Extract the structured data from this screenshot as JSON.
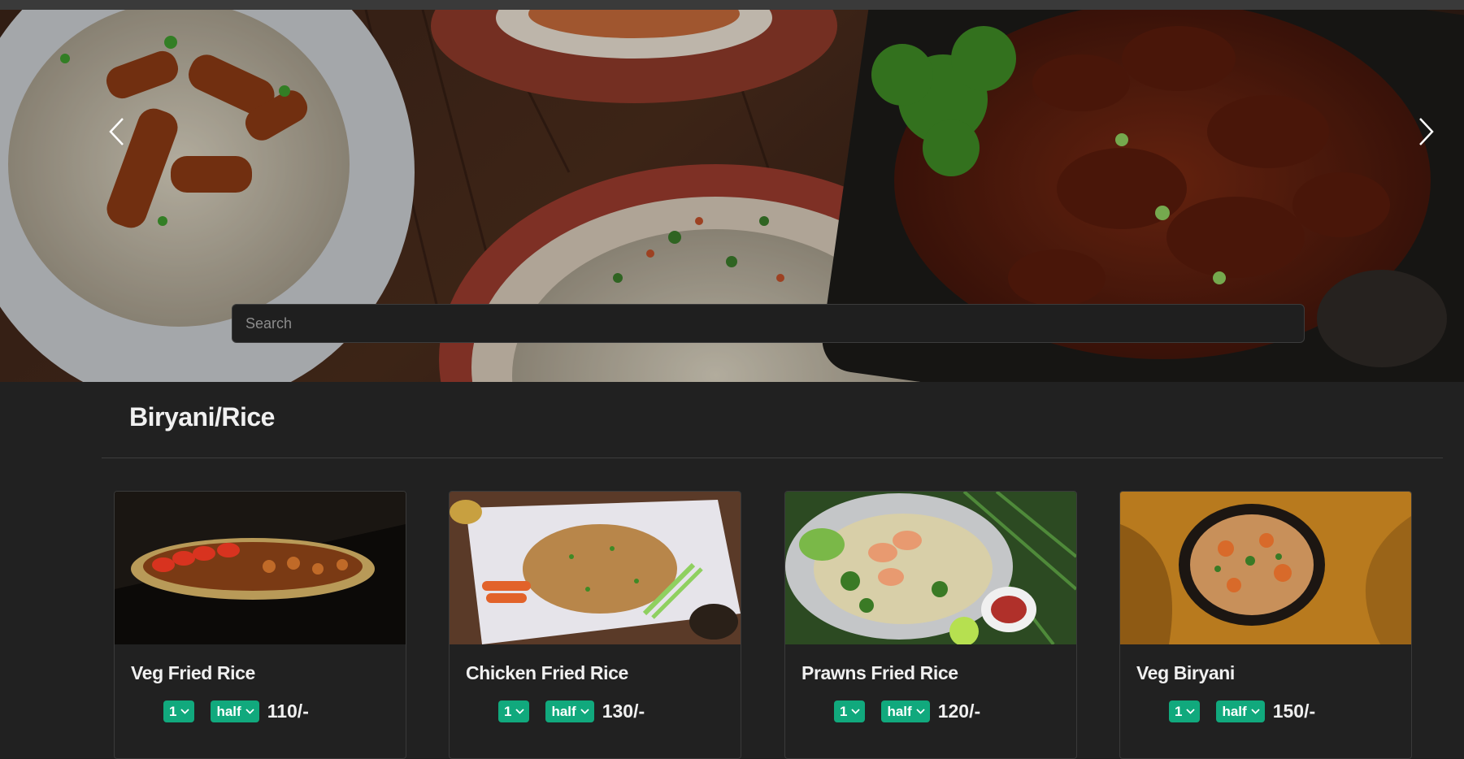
{
  "hero": {
    "search_placeholder": "Search",
    "prev_icon": "chevron-left-icon",
    "next_icon": "chevron-right-icon"
  },
  "section": {
    "title": "Biryani/Rice"
  },
  "colors": {
    "accent": "#11a97d",
    "background": "#212121",
    "text": "#f0f0f0"
  },
  "items": [
    {
      "name": "Veg Fried Rice",
      "qty": "1",
      "size": "half",
      "price": "110/-"
    },
    {
      "name": "Chicken Fried Rice",
      "qty": "1",
      "size": "half",
      "price": "130/-"
    },
    {
      "name": "Prawns Fried Rice",
      "qty": "1",
      "size": "half",
      "price": "120/-"
    },
    {
      "name": "Veg Biryani",
      "qty": "1",
      "size": "half",
      "price": "150/-"
    }
  ]
}
